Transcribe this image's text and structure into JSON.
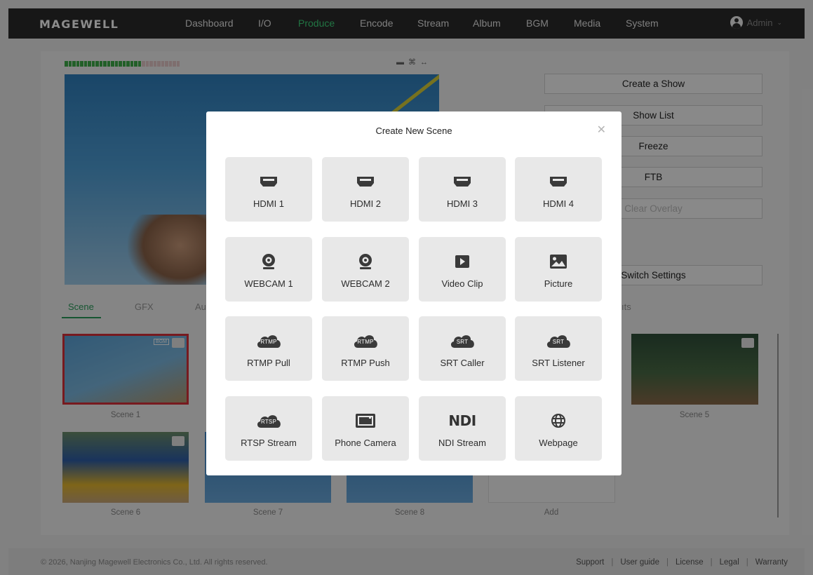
{
  "app": {
    "logo": "MAGEWELL",
    "user": "Admin"
  },
  "nav": [
    {
      "label": "Dashboard",
      "active": false
    },
    {
      "label": "I/O",
      "active": false
    },
    {
      "label": "Produce",
      "active": true
    },
    {
      "label": "Encode",
      "active": false
    },
    {
      "label": "Stream",
      "active": false
    },
    {
      "label": "Album",
      "active": false
    },
    {
      "label": "BGM",
      "active": false
    },
    {
      "label": "Media",
      "active": false
    },
    {
      "label": "System",
      "active": false
    }
  ],
  "side_buttons": [
    {
      "label": "Create a Show",
      "enabled": true
    },
    {
      "label": "Show List",
      "enabled": true
    },
    {
      "label": "Freeze",
      "enabled": true
    },
    {
      "label": "FTB",
      "enabled": true
    },
    {
      "label": "Clear Overlay",
      "enabled": false
    },
    {
      "label": "Switch Settings",
      "enabled": true
    }
  ],
  "tabs": [
    {
      "label": "Scene",
      "active": true
    },
    {
      "label": "GFX",
      "active": false
    },
    {
      "label": "Au",
      "active": false
    },
    {
      "label": "ıts",
      "active": false
    }
  ],
  "scenes": [
    {
      "label": "Scene 1",
      "selected": true,
      "badge": "BGM"
    },
    {
      "label": "Scene 5",
      "selected": false
    },
    {
      "label": "Scene 6",
      "selected": false
    },
    {
      "label": "Scene 7",
      "selected": false
    },
    {
      "label": "Scene 8",
      "selected": false
    }
  ],
  "add_label": "Add",
  "modal": {
    "title": "Create New Scene",
    "close_icon": "close-icon",
    "sources": [
      {
        "label": "HDMI 1",
        "icon": "hdmi-icon"
      },
      {
        "label": "HDMI 2",
        "icon": "hdmi-icon"
      },
      {
        "label": "HDMI 3",
        "icon": "hdmi-icon"
      },
      {
        "label": "HDMI 4",
        "icon": "hdmi-icon"
      },
      {
        "label": "WEBCAM 1",
        "icon": "webcam-icon"
      },
      {
        "label": "WEBCAM 2",
        "icon": "webcam-icon"
      },
      {
        "label": "Video Clip",
        "icon": "play-icon"
      },
      {
        "label": "Picture",
        "icon": "picture-icon"
      },
      {
        "label": "RTMP Pull",
        "icon": "cloud-icon",
        "icon_text": "RTMP"
      },
      {
        "label": "RTMP Push",
        "icon": "cloud-icon",
        "icon_text": "RTMP"
      },
      {
        "label": "SRT Caller",
        "icon": "cloud-icon",
        "icon_text": "SRT"
      },
      {
        "label": "SRT Listener",
        "icon": "cloud-icon",
        "icon_text": "SRT"
      },
      {
        "label": "RTSP Stream",
        "icon": "cloud-icon",
        "icon_text": "RTSP"
      },
      {
        "label": "Phone Camera",
        "icon": "phone-camera-icon"
      },
      {
        "label": "NDI Stream",
        "icon": "ndi-icon",
        "icon_text": "NDI"
      },
      {
        "label": "Webpage",
        "icon": "globe-icon"
      }
    ]
  },
  "footer": {
    "copyright": "© 2026, Nanjing Magewell Electronics Co., Ltd. All rights reserved.",
    "links": [
      "Support",
      "User guide",
      "License",
      "Legal",
      "Warranty"
    ]
  },
  "colors": {
    "nav_active": "#3dd67a",
    "tab_active": "#2a9d5c",
    "selected_outline": "#d9303a",
    "tile_bg": "#e8e8e8",
    "icon_dark": "#3a3a3a"
  }
}
